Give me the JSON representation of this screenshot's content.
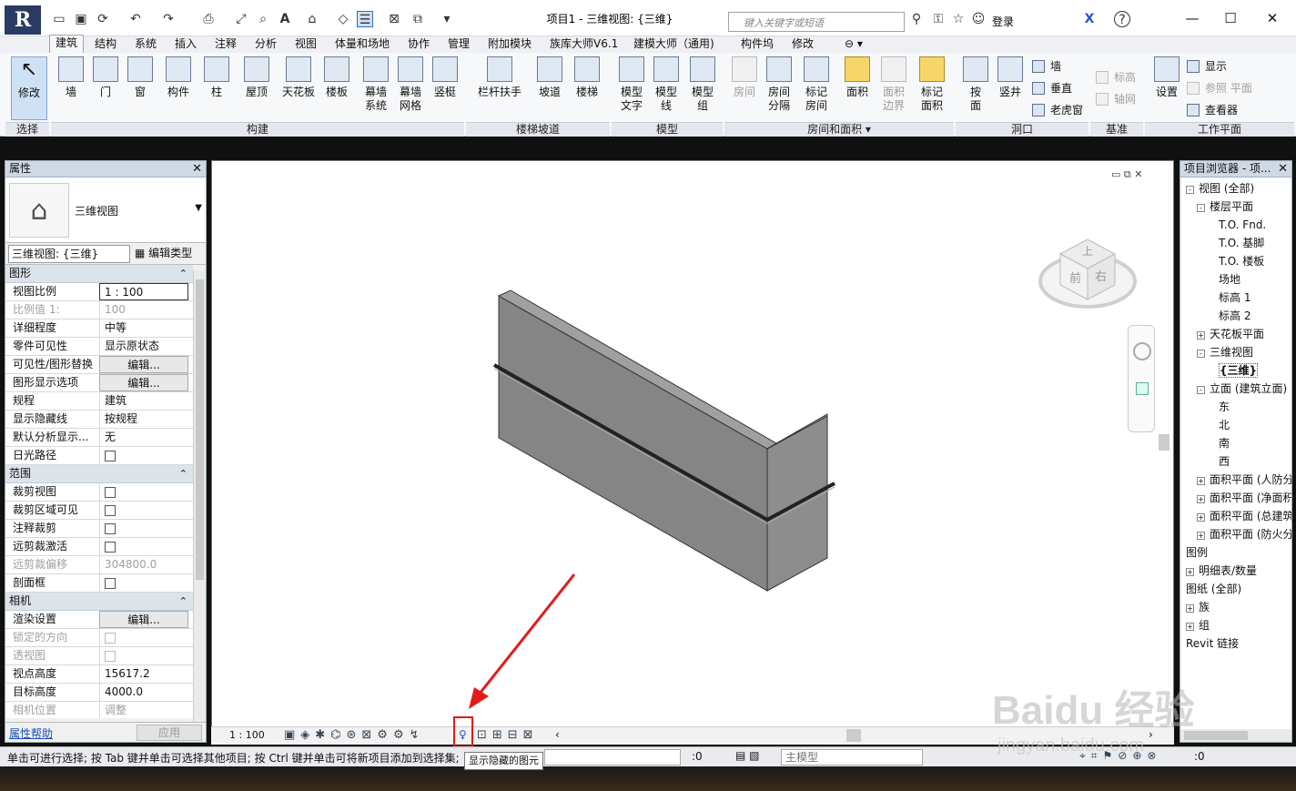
{
  "title": "项目1 - 三维视图: {三维}",
  "app_letter": "R",
  "search_placeholder": "键入关键字或短语",
  "login": "登录",
  "tabs": [
    "建筑",
    "结构",
    "系统",
    "插入",
    "注释",
    "分析",
    "视图",
    "体量和场地",
    "协作",
    "管理",
    "附加模块",
    "族库大师V6.1",
    "建模大师（通用)",
    "构件坞",
    "修改"
  ],
  "ribbon": {
    "select": {
      "label": "修改",
      "panel": "选择"
    },
    "build": [
      "墙",
      "门",
      "窗",
      "构件",
      "柱",
      "屋顶",
      "天花板",
      "楼板",
      "幕墙\n系统",
      "幕墙\n网格",
      "竖梃"
    ],
    "build_panel": "构建",
    "stairs": [
      "栏杆扶手",
      "坡道",
      "楼梯"
    ],
    "stairs_panel": "楼梯坡道",
    "model": [
      "模型\n文字",
      "模型\n线",
      "模型\n组"
    ],
    "model_panel": "模型",
    "room": [
      "房间",
      "房间\n分隔",
      "标记\n房间",
      "面积",
      "面积\n边界",
      "标记\n面积"
    ],
    "room_panel": "房间和面积 ▾",
    "opening": [
      "按\n面",
      "竖井"
    ],
    "opening_small": [
      "墙",
      "垂直",
      "老虎窗"
    ],
    "opening_panel": "洞口",
    "datum_small": [
      "标高",
      "轴网"
    ],
    "datum_panel": "基准",
    "workplane_btn": "设置",
    "workplane_small": [
      "显示",
      "参照 平面",
      "查看器"
    ],
    "workplane_panel": "工作平面"
  },
  "properties": {
    "header": "属性",
    "type_name": "三维视图",
    "selector": "三维视图: {三维}",
    "edit_type": "编辑类型",
    "sections": {
      "graphics": "图形",
      "extents": "范围",
      "camera": "相机"
    },
    "graphics_rows": [
      {
        "k": "视图比例",
        "v": "1 : 100"
      },
      {
        "k": "比例值 1:",
        "v": "100"
      },
      {
        "k": "详细程度",
        "v": "中等"
      },
      {
        "k": "零件可见性",
        "v": "显示原状态"
      },
      {
        "k": "可见性/图形替换",
        "v": "编辑..."
      },
      {
        "k": "图形显示选项",
        "v": "编辑..."
      },
      {
        "k": "规程",
        "v": "建筑"
      },
      {
        "k": "显示隐藏线",
        "v": "按规程"
      },
      {
        "k": "默认分析显示...",
        "v": "无"
      },
      {
        "k": "日光路径",
        "v": ""
      }
    ],
    "extents_rows": [
      {
        "k": "裁剪视图",
        "v": ""
      },
      {
        "k": "裁剪区域可见",
        "v": ""
      },
      {
        "k": "注释裁剪",
        "v": ""
      },
      {
        "k": "远剪裁激活",
        "v": ""
      },
      {
        "k": "远剪裁偏移",
        "v": "304800.0"
      },
      {
        "k": "剖面框",
        "v": ""
      }
    ],
    "camera_rows": [
      {
        "k": "渲染设置",
        "v": "编辑..."
      },
      {
        "k": "锁定的方向",
        "v": ""
      },
      {
        "k": "透视图",
        "v": ""
      },
      {
        "k": "视点高度",
        "v": "15617.2"
      },
      {
        "k": "目标高度",
        "v": "4000.0"
      },
      {
        "k": "相机位置",
        "v": "调整"
      }
    ],
    "help_link": "属性帮助",
    "apply": "应用"
  },
  "view": {
    "scale": "1 : 100",
    "viewcube_front": "前",
    "viewcube_right": "右",
    "viewcube_top": "上",
    "tooltip": "显示隐藏的图元"
  },
  "browser": {
    "header": "项目浏览器 - 项...",
    "nodes": [
      {
        "t": "视图 (全部)",
        "indent": 0,
        "exp": "-"
      },
      {
        "t": "楼层平面",
        "indent": 1,
        "exp": "-"
      },
      {
        "t": "T.O. Fnd.",
        "indent": 3,
        "exp": ""
      },
      {
        "t": "T.O. 基脚",
        "indent": 3,
        "exp": ""
      },
      {
        "t": "T.O. 楼板",
        "indent": 3,
        "exp": ""
      },
      {
        "t": "场地",
        "indent": 3,
        "exp": ""
      },
      {
        "t": "标高 1",
        "indent": 3,
        "exp": ""
      },
      {
        "t": "标高 2",
        "indent": 3,
        "exp": ""
      },
      {
        "t": "天花板平面",
        "indent": 1,
        "exp": "+"
      },
      {
        "t": "三维视图",
        "indent": 1,
        "exp": "-"
      },
      {
        "t": "{三维}",
        "indent": 3,
        "exp": ""
      },
      {
        "t": "立面 (建筑立面)",
        "indent": 1,
        "exp": "-"
      },
      {
        "t": "东",
        "indent": 3,
        "exp": ""
      },
      {
        "t": "北",
        "indent": 3,
        "exp": ""
      },
      {
        "t": "南",
        "indent": 3,
        "exp": ""
      },
      {
        "t": "西",
        "indent": 3,
        "exp": ""
      },
      {
        "t": "面积平面 (人防分区面积)",
        "indent": 1,
        "exp": "+"
      },
      {
        "t": "面积平面 (净面积)",
        "indent": 1,
        "exp": "+"
      },
      {
        "t": "面积平面 (总建筑面积)",
        "indent": 1,
        "exp": "+"
      },
      {
        "t": "面积平面 (防火分区面积)",
        "indent": 1,
        "exp": "+"
      },
      {
        "t": "图例",
        "indent": 0,
        "exp": ""
      },
      {
        "t": "明细表/数量",
        "indent": 0,
        "exp": "+"
      },
      {
        "t": "图纸 (全部)",
        "indent": 0,
        "exp": ""
      },
      {
        "t": "族",
        "indent": 0,
        "exp": "+"
      },
      {
        "t": "组",
        "indent": 0,
        "exp": "+"
      },
      {
        "t": "Revit 链接",
        "indent": 0,
        "exp": ""
      }
    ]
  },
  "status": {
    "message": "单击可进行选择; 按 Tab 键并单击可选择其他项目; 按 Ctrl 键并单击可将新项目添加到选择集;",
    "count": ":0",
    "model": "主模型",
    "filter": ":0"
  },
  "watermark": "Baidu 经验",
  "watermark_url": "jingyan.baidu.com"
}
